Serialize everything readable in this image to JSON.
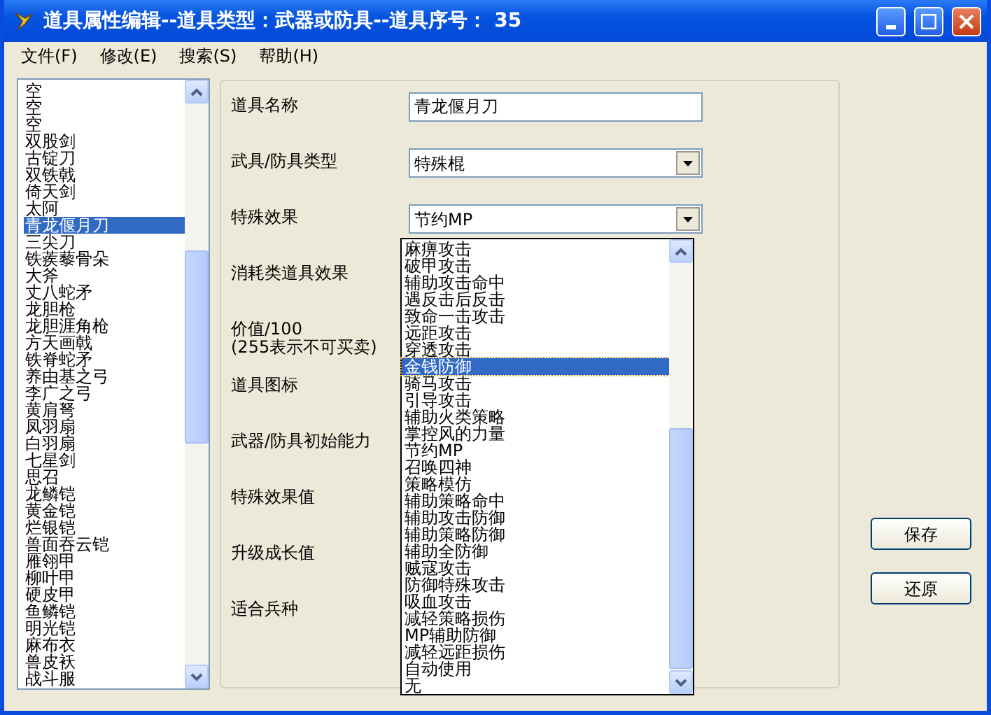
{
  "window": {
    "title": "道具属性编辑--道具类型：武器或防具--道具序号： 35"
  },
  "menu": [
    {
      "label": "文件(F)"
    },
    {
      "label": "修改(E)"
    },
    {
      "label": "搜索(S)"
    },
    {
      "label": "帮助(H)"
    }
  ],
  "item_list": [
    {
      "label": "空",
      "selected": false
    },
    {
      "label": "空",
      "selected": false
    },
    {
      "label": "空",
      "selected": false
    },
    {
      "label": "双股剑",
      "selected": false
    },
    {
      "label": "古锭刀",
      "selected": false
    },
    {
      "label": "双铁戟",
      "selected": false
    },
    {
      "label": "倚天剑",
      "selected": false
    },
    {
      "label": "太阿",
      "selected": false
    },
    {
      "label": "青龙偃月刀",
      "selected": true
    },
    {
      "label": "三尖刀",
      "selected": false
    },
    {
      "label": "铁蒺藜骨朵",
      "selected": false
    },
    {
      "label": "大斧",
      "selected": false
    },
    {
      "label": "丈八蛇矛",
      "selected": false
    },
    {
      "label": "龙胆枪",
      "selected": false
    },
    {
      "label": "龙胆涯角枪",
      "selected": false
    },
    {
      "label": "方天画戟",
      "selected": false
    },
    {
      "label": "铁脊蛇矛",
      "selected": false
    },
    {
      "label": "养由基之弓",
      "selected": false
    },
    {
      "label": "李广之弓",
      "selected": false
    },
    {
      "label": "黄肩弩",
      "selected": false
    },
    {
      "label": "凤羽扇",
      "selected": false
    },
    {
      "label": "白羽扇",
      "selected": false
    },
    {
      "label": "七星剑",
      "selected": false
    },
    {
      "label": "思召",
      "selected": false
    },
    {
      "label": "龙鳞铠",
      "selected": false
    },
    {
      "label": "黄金铠",
      "selected": false
    },
    {
      "label": "烂银铠",
      "selected": false
    },
    {
      "label": "兽面吞云铠",
      "selected": false
    },
    {
      "label": "雁翎甲",
      "selected": false
    },
    {
      "label": "柳叶甲",
      "selected": false
    },
    {
      "label": "硬皮甲",
      "selected": false
    },
    {
      "label": "鱼鳞铠",
      "selected": false
    },
    {
      "label": "明光铠",
      "selected": false
    },
    {
      "label": "麻布衣",
      "selected": false
    },
    {
      "label": "兽皮袄",
      "selected": false
    },
    {
      "label": "战斗服",
      "selected": false
    }
  ],
  "form": [
    {
      "label": "道具名称",
      "kind": "text",
      "value": "青龙偃月刀"
    },
    {
      "label": "武具/防具类型",
      "kind": "combo",
      "value": "特殊棍"
    },
    {
      "label": "特殊效果",
      "kind": "combo",
      "value": "节约MP"
    },
    {
      "label": "消耗类道具效果",
      "kind": "none"
    },
    {
      "label": "价值/100",
      "note": "(255表示不可买卖)",
      "kind": "none"
    },
    {
      "label": "道具图标",
      "kind": "none"
    },
    {
      "label": "武器/防具初始能力",
      "kind": "none"
    },
    {
      "label": "特殊效果值",
      "kind": "none"
    },
    {
      "label": "升级成长值",
      "kind": "none"
    },
    {
      "label": "适合兵种",
      "kind": "none"
    }
  ],
  "dropdown": [
    {
      "label": "麻痹攻击",
      "selected": false
    },
    {
      "label": "破甲攻击",
      "selected": false
    },
    {
      "label": "辅助攻击命中",
      "selected": false
    },
    {
      "label": "遇反击后反击",
      "selected": false
    },
    {
      "label": "致命一击攻击",
      "selected": false
    },
    {
      "label": "远距攻击",
      "selected": false
    },
    {
      "label": "穿透攻击",
      "selected": false
    },
    {
      "label": "金钱防御",
      "selected": true
    },
    {
      "label": "骑马攻击",
      "selected": false
    },
    {
      "label": "引导攻击",
      "selected": false
    },
    {
      "label": "辅助火类策略",
      "selected": false
    },
    {
      "label": "掌控风的力量",
      "selected": false
    },
    {
      "label": "节约MP",
      "selected": false
    },
    {
      "label": "召唤四神",
      "selected": false
    },
    {
      "label": "策略模仿",
      "selected": false
    },
    {
      "label": "辅助策略命中",
      "selected": false
    },
    {
      "label": "辅助攻击防御",
      "selected": false
    },
    {
      "label": "辅助策略防御",
      "selected": false
    },
    {
      "label": "辅助全防御",
      "selected": false
    },
    {
      "label": "贼寇攻击",
      "selected": false
    },
    {
      "label": "防御特殊攻击",
      "selected": false
    },
    {
      "label": "吸血攻击",
      "selected": false
    },
    {
      "label": "减轻策略损伤",
      "selected": false
    },
    {
      "label": "MP辅助防御",
      "selected": false
    },
    {
      "label": "减轻远距损伤",
      "selected": false
    },
    {
      "label": "自动使用",
      "selected": false
    },
    {
      "label": "无",
      "selected": false
    }
  ],
  "buttons": [
    {
      "label": "保存"
    },
    {
      "label": "还原"
    }
  ]
}
